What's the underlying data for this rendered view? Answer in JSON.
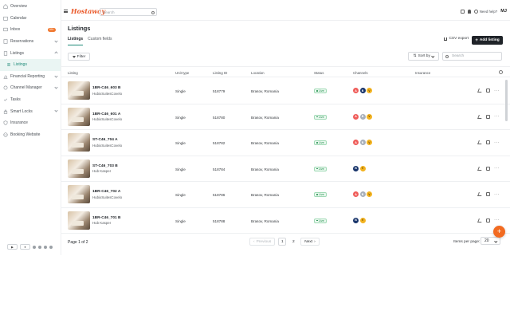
{
  "sidebar": {
    "items": [
      {
        "label": "Overview",
        "icon": "home-icon"
      },
      {
        "label": "Calendar",
        "icon": "calendar-icon"
      },
      {
        "label": "Inbox",
        "icon": "inbox-icon",
        "badge": "99+"
      },
      {
        "label": "Reservations",
        "icon": "reservations-icon"
      },
      {
        "label": "Listings",
        "icon": "building-icon"
      },
      {
        "label": "Listings",
        "icon": "list-icon"
      },
      {
        "label": "Financial Reporting",
        "icon": "chart-icon"
      },
      {
        "label": "Channel Manager",
        "icon": "channel-icon"
      },
      {
        "label": "Tasks",
        "icon": "tasks-icon"
      },
      {
        "label": "Smart Locks",
        "icon": "lock-icon"
      },
      {
        "label": "Insurance",
        "icon": "shield-icon"
      },
      {
        "label": "Booking Website",
        "icon": "globe-icon"
      }
    ]
  },
  "header": {
    "logo": "Hostaway",
    "search_placeholder": "Search",
    "help": "Need help?",
    "avatar": "MJ"
  },
  "main": {
    "title": "Listings",
    "tabs": [
      {
        "label": "Listings"
      },
      {
        "label": "Custom fields"
      }
    ],
    "csv_export": "CSV export",
    "add_listing": "Add listing",
    "filter": "Filter",
    "sort_by": "Sort by",
    "search_placeholder": "Search"
  },
  "table": {
    "columns": [
      "Listing",
      "Unit type",
      "Listing ID",
      "Location",
      "Status",
      "Channels",
      "Insurance"
    ],
    "rows": [
      {
        "name": "1BR-C46_603 B",
        "sub": "HubixSuitesCovelo",
        "unit_type": "Single",
        "listing_id": "518779",
        "location": "Brasov, Romania",
        "status": "Live",
        "channels": [
          {
            "k": "airbnb",
            "t": "A"
          },
          {
            "k": "booking",
            "t": "B"
          },
          {
            "k": "vrbo",
            "t": "V"
          }
        ]
      },
      {
        "name": "1BR-C46_601 A",
        "sub": "HubixSuitesCovelo",
        "unit_type": "Single",
        "listing_id": "518780",
        "location": "Brasov, Romania",
        "status": "Live",
        "channels": [
          {
            "k": "airbnb",
            "t": "A"
          },
          {
            "k": "gray",
            "t": "B"
          },
          {
            "k": "vrbo",
            "t": "V"
          }
        ]
      },
      {
        "name": "ST-C46_704 A",
        "sub": "HubixSuitesCovelo",
        "unit_type": "Single",
        "listing_id": "518782",
        "location": "Brasov, Romania",
        "status": "Live",
        "channels": [
          {
            "k": "airbnb",
            "t": "A"
          },
          {
            "k": "gray",
            "t": "B"
          },
          {
            "k": "vrbo",
            "t": "V"
          }
        ]
      },
      {
        "name": "ST-C46_703 B",
        "sub": "Hub Kasper",
        "unit_type": "Single",
        "listing_id": "518784",
        "location": "Brasov, Romania",
        "status": "Live",
        "channels": [
          {
            "k": "booking",
            "t": "B"
          },
          {
            "k": "vrbo",
            "t": "V"
          }
        ]
      },
      {
        "name": "1BR-C46_702 A",
        "sub": "HubixSuitesCovelo",
        "unit_type": "Single",
        "listing_id": "518786",
        "location": "Brasov, Romania",
        "status": "Live",
        "channels": [
          {
            "k": "airbnb",
            "t": "A"
          },
          {
            "k": "gray",
            "t": "B"
          },
          {
            "k": "vrbo",
            "t": "V"
          }
        ]
      },
      {
        "name": "1BR-C46_701 B",
        "sub": "Hub Kasper",
        "unit_type": "Single",
        "listing_id": "518788",
        "location": "Brasov, Romania",
        "status": "Live",
        "channels": [
          {
            "k": "booking",
            "t": "B"
          },
          {
            "k": "vrbo",
            "t": "V"
          }
        ]
      }
    ]
  },
  "pagination": {
    "page_of": "Page 1 of 2",
    "previous": "Previous",
    "pages": [
      "1",
      "2"
    ],
    "next": "Next",
    "items_per_page_label": "Items per page:",
    "items_per_page": "20"
  },
  "colors": {
    "accent": "#1e8a78",
    "brand": "#ea5a2b",
    "fab": "#f26b21",
    "live": "#1e8e4b"
  }
}
